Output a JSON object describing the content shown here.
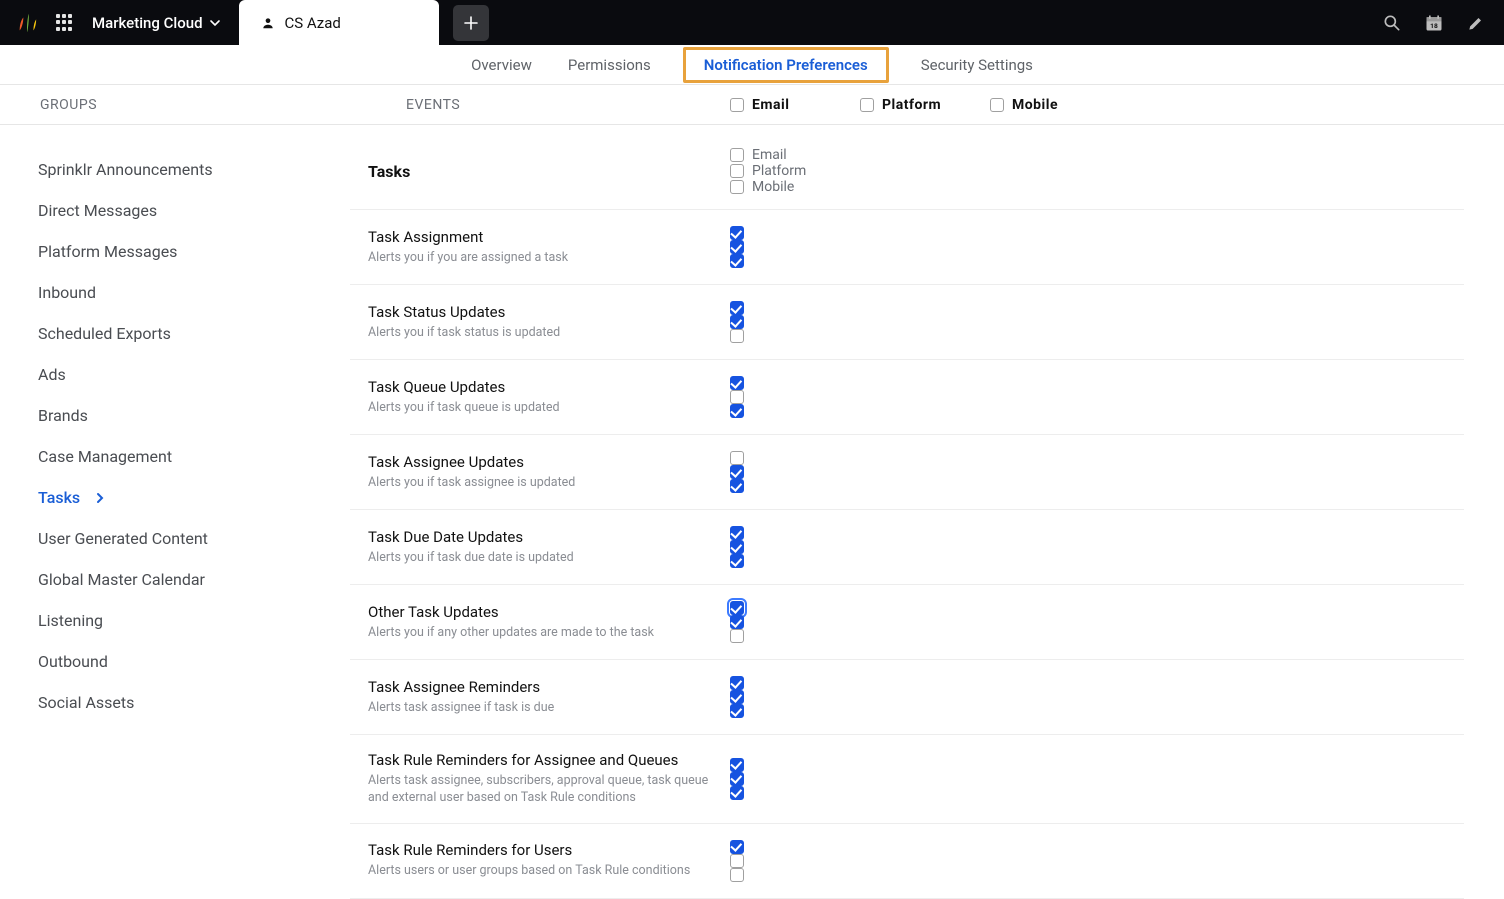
{
  "topbar": {
    "cloud_label": "Marketing Cloud",
    "tab_user": "CS Azad"
  },
  "subnav": {
    "tabs": [
      {
        "label": "Overview",
        "selected": false
      },
      {
        "label": "Permissions",
        "selected": false
      },
      {
        "label": "Notification Preferences",
        "selected": true
      },
      {
        "label": "Security Settings",
        "selected": false
      }
    ]
  },
  "colheaders": {
    "groups": "GROUPS",
    "events": "EVENTS",
    "channels": [
      {
        "label": "Email",
        "checked": false
      },
      {
        "label": "Platform",
        "checked": false
      },
      {
        "label": "Mobile",
        "checked": false
      }
    ]
  },
  "sidebar": {
    "items": [
      {
        "label": "Sprinklr Announcements",
        "selected": false
      },
      {
        "label": "Direct Messages",
        "selected": false
      },
      {
        "label": "Platform Messages",
        "selected": false
      },
      {
        "label": "Inbound",
        "selected": false
      },
      {
        "label": "Scheduled Exports",
        "selected": false
      },
      {
        "label": "Ads",
        "selected": false
      },
      {
        "label": "Brands",
        "selected": false
      },
      {
        "label": "Case Management",
        "selected": false
      },
      {
        "label": "Tasks",
        "selected": true
      },
      {
        "label": "User Generated Content",
        "selected": false
      },
      {
        "label": "Global Master Calendar",
        "selected": false
      },
      {
        "label": "Listening",
        "selected": false
      },
      {
        "label": "Outbound",
        "selected": false
      },
      {
        "label": "Social Assets",
        "selected": false
      }
    ]
  },
  "section": {
    "title": "Tasks",
    "channels": [
      {
        "label": "Email",
        "checked": false
      },
      {
        "label": "Platform",
        "checked": false
      },
      {
        "label": "Mobile",
        "checked": false
      }
    ],
    "events": [
      {
        "name": "Task Assignment",
        "desc": "Alerts you if you are assigned a task",
        "email": true,
        "platform": true,
        "mobile": true
      },
      {
        "name": "Task Status Updates",
        "desc": "Alerts you if task status is updated",
        "email": true,
        "platform": true,
        "mobile": false
      },
      {
        "name": "Task Queue Updates",
        "desc": "Alerts you if task queue is updated",
        "email": true,
        "platform": false,
        "mobile": true
      },
      {
        "name": "Task Assignee Updates",
        "desc": "Alerts you if task assignee is updated",
        "email": false,
        "platform": true,
        "mobile": true
      },
      {
        "name": "Task Due Date Updates",
        "desc": "Alerts you if task due date is updated",
        "email": true,
        "platform": true,
        "mobile": true
      },
      {
        "name": "Other Task Updates",
        "desc": "Alerts you if any other updates are made to the task",
        "email": true,
        "platform": true,
        "mobile": false,
        "email_focused": true
      },
      {
        "name": "Task Assignee Reminders",
        "desc": "Alerts task assignee if task is due",
        "email": true,
        "platform": true,
        "mobile": true
      },
      {
        "name": "Task Rule Reminders for Assignee and Queues",
        "desc": "Alerts task assignee, subscribers, approval queue, task queue and external user based on Task Rule conditions",
        "email": true,
        "platform": true,
        "mobile": true
      },
      {
        "name": "Task Rule Reminders for Users",
        "desc": "Alerts users or user groups based on Task Rule conditions",
        "email": true,
        "platform": false,
        "mobile": false
      }
    ]
  }
}
